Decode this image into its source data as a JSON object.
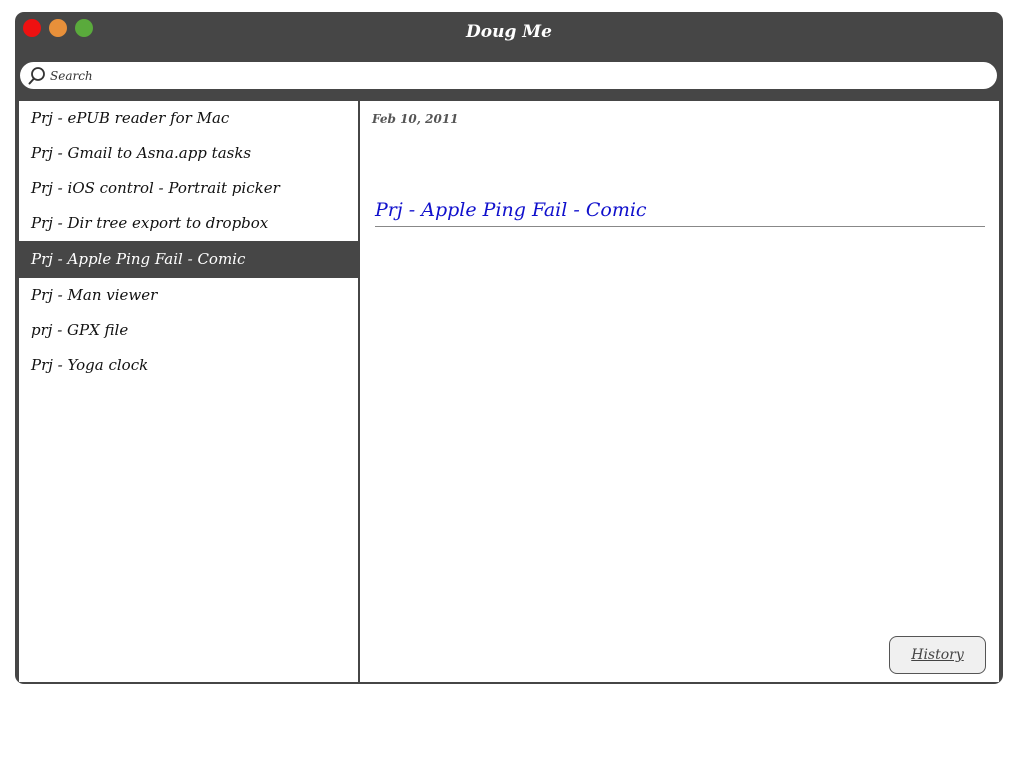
{
  "window": {
    "title": "Doug Me",
    "controls": {
      "close_color": "#ee1111",
      "minimize_color": "#e8903a",
      "zoom_color": "#5aaa3c"
    }
  },
  "colors": {
    "chrome": "#464646",
    "title_accent": "#1010cc"
  },
  "search": {
    "placeholder": "Search",
    "value": "",
    "icon": "search-icon"
  },
  "notes": [
    {
      "label": "Prj - ePUB reader for Mac",
      "selected": false
    },
    {
      "label": "Prj - Gmail to Asna.app tasks",
      "selected": false
    },
    {
      "label": "Prj - iOS control - Portrait picker",
      "selected": false
    },
    {
      "label": "Prj - Dir tree export to dropbox",
      "selected": false
    },
    {
      "label": "Prj - Apple Ping Fail  - Comic",
      "selected": true
    },
    {
      "label": "Prj - Man viewer",
      "selected": false
    },
    {
      "label": "prj - GPX file",
      "selected": false
    },
    {
      "label": "Prj - Yoga clock",
      "selected": false
    }
  ],
  "detail": {
    "date": "Feb 10, 2011",
    "title": "Prj - Apple Ping Fail - Comic",
    "history_label": "History"
  }
}
